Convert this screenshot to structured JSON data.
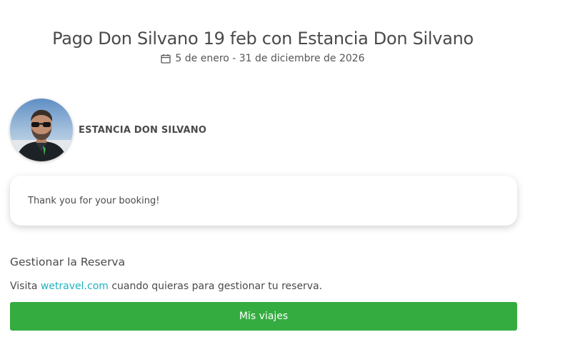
{
  "header": {
    "title": "Pago Don Silvano 19 feb con Estancia Don Silvano",
    "dates": "5 de enero - 31 de diciembre de 2026",
    "calendar_icon": "calendar-icon"
  },
  "host": {
    "name": "ESTANCIA DON SILVANO"
  },
  "message": {
    "text": "Thank you for your booking!"
  },
  "manage": {
    "heading": "Gestionar la Reserva",
    "desc_prefix": "Visita ",
    "link_text": "wetravel.com",
    "desc_suffix": " cuando quieras para gestionar tu reserva.",
    "button_label": "Mis viajes"
  },
  "colors": {
    "button": "#34ac40",
    "link": "#1fb2c0",
    "text": "#4a4a4a"
  }
}
